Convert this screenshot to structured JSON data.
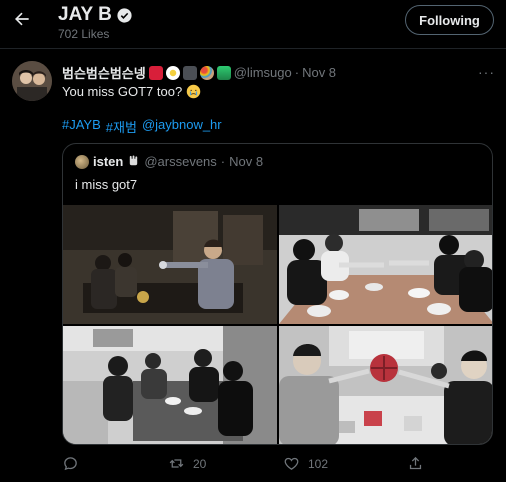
{
  "header": {
    "title": "JAY B",
    "subtitle": "702 Likes",
    "follow_label": "Following"
  },
  "tweet": {
    "author_name": "범슨범슨범슨넹",
    "handle": "@limsugo",
    "separator": "·",
    "date": "Nov 8",
    "text": "You miss GOT7 too?",
    "hashtags": [
      "#JAYB",
      "#재범",
      "@jaybnow_hr"
    ],
    "more_label": "···"
  },
  "quoted": {
    "author_name": "isten",
    "handle": "@arssevens",
    "separator": "·",
    "date": "Nov 8",
    "text": "i miss got7"
  },
  "actions": {
    "reply_count": "",
    "retweet_count": "20",
    "like_count": "102"
  },
  "colors": {
    "background": "#000000",
    "text": "#e7e9ea",
    "muted": "#71767b",
    "link": "#1d9bf0",
    "border": "#2f3336"
  }
}
